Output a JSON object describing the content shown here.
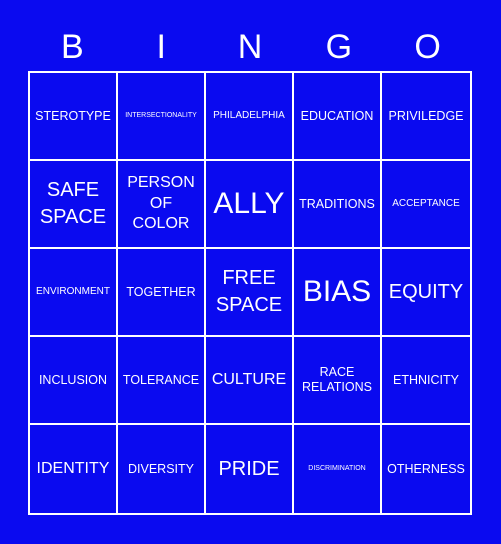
{
  "header": {
    "letters": [
      "B",
      "I",
      "N",
      "G",
      "O"
    ]
  },
  "colors": {
    "background": "#0a0af0",
    "text": "#ffffff",
    "grid_lines": "#ffffff"
  },
  "cells": [
    {
      "text": "STEROTYPE",
      "size": "md"
    },
    {
      "text": "INTERSECTIONALITY",
      "size": "xs"
    },
    {
      "text": "PHILADELPHIA",
      "size": "sm"
    },
    {
      "text": "EDUCATION",
      "size": "md"
    },
    {
      "text": "PRIVILEDGE",
      "size": "md"
    },
    {
      "text": "SAFE SPACE",
      "size": "xl"
    },
    {
      "text": "PERSON OF COLOR",
      "size": "lg"
    },
    {
      "text": "ALLY",
      "size": "xxl"
    },
    {
      "text": "TRADITIONS",
      "size": "md"
    },
    {
      "text": "ACCEPTANCE",
      "size": "sm"
    },
    {
      "text": "ENVIRONMENT",
      "size": "sm"
    },
    {
      "text": "TOGETHER",
      "size": "md"
    },
    {
      "text": "FREE SPACE",
      "size": "xl"
    },
    {
      "text": "BIAS",
      "size": "xxl"
    },
    {
      "text": "EQUITY",
      "size": "xl"
    },
    {
      "text": "INCLUSION",
      "size": "md"
    },
    {
      "text": "TOLERANCE",
      "size": "md"
    },
    {
      "text": "CULTURE",
      "size": "lg"
    },
    {
      "text": "RACE RELATIONS",
      "size": "md"
    },
    {
      "text": "ETHNICITY",
      "size": "md"
    },
    {
      "text": "IDENTITY",
      "size": "lg"
    },
    {
      "text": "DIVERSITY",
      "size": "md"
    },
    {
      "text": "PRIDE",
      "size": "xl"
    },
    {
      "text": "DISCRIMINATION",
      "size": "xs"
    },
    {
      "text": "OTHERNESS",
      "size": "md"
    }
  ]
}
